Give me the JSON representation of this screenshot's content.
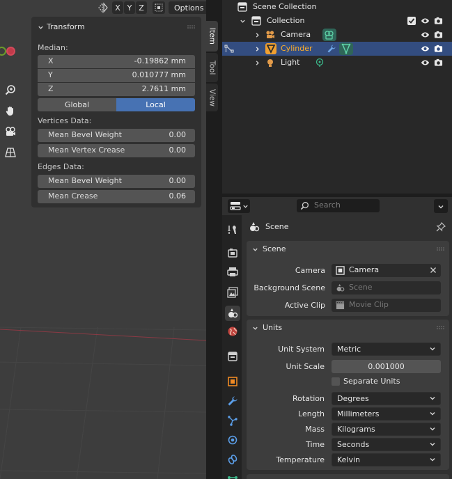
{
  "viewport": {
    "header": {
      "axis_x": "X",
      "axis_y": "Y",
      "axis_z": "Z",
      "options_label": "Options"
    },
    "npanel": {
      "title": "Transform",
      "median_label": "Median:",
      "x_label": "X",
      "x_value": "-0.19862 mm",
      "y_label": "Y",
      "y_value": "0.010777 mm",
      "z_label": "Z",
      "z_value": "2.7611 mm",
      "global_label": "Global",
      "local_label": "Local",
      "vertices_heading": "Vertices Data:",
      "mean_bevel_weight_label": "Mean Bevel Weight",
      "mean_bevel_weight_v": "0.00",
      "mean_vertex_crease_label": "Mean Vertex Crease",
      "mean_vertex_crease_v": "0.00",
      "edges_heading": "Edges Data:",
      "edge_bevel_weight_label": "Mean Bevel Weight",
      "edge_bevel_weight_v": "0.00",
      "mean_crease_label": "Mean Crease",
      "mean_crease_v": "0.06"
    },
    "tabs": [
      "Item",
      "Tool",
      "View"
    ]
  },
  "outliner": {
    "scene_collection": "Scene Collection",
    "collection": "Collection",
    "camera": "Camera",
    "cylinder": "Cylinder",
    "light": "Light"
  },
  "properties": {
    "search_placeholder": "Search",
    "context_title": "Scene",
    "scene_panel": {
      "title": "Scene",
      "camera_label": "Camera",
      "camera_value": "Camera",
      "background_scene_label": "Background Scene",
      "background_scene_placeholder": "Scene",
      "active_clip_label": "Active Clip",
      "active_clip_placeholder": "Movie Clip"
    },
    "units_panel": {
      "title": "Units",
      "unit_system_label": "Unit System",
      "unit_system_value": "Metric",
      "unit_scale_label": "Unit Scale",
      "unit_scale_value": "0.001000",
      "separate_units_label": "Separate Units",
      "rotation_label": "Rotation",
      "rotation_value": "Degrees",
      "length_label": "Length",
      "length_value": "Millimeters",
      "mass_label": "Mass",
      "mass_value": "Kilograms",
      "time_label": "Time",
      "time_value": "Seconds",
      "temperature_label": "Temperature",
      "temperature_value": "Kelvin"
    }
  },
  "colors": {
    "accent_blue": "#4772b3",
    "selection_row": "#334d80",
    "selected_text": "#ffaf29",
    "object_data_green": "#3bb78a"
  }
}
